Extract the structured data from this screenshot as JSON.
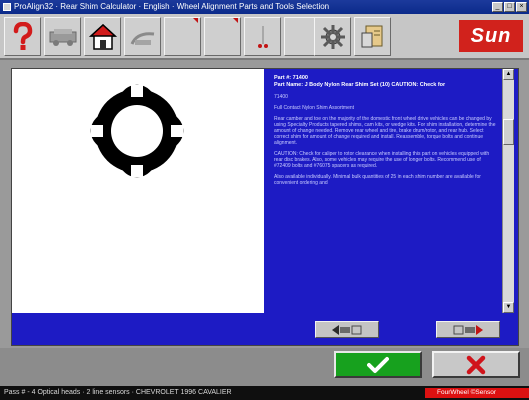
{
  "window": {
    "title": "ProAlign32 · Rear Shim Calculator · English · Wheel Alignment Parts and Tools Selection"
  },
  "toolbar": {
    "buttons": [
      {
        "name": "help-icon"
      },
      {
        "name": "vehicle-icon"
      },
      {
        "name": "home-icon"
      },
      {
        "name": "measure-icon"
      },
      {
        "name": "blank-1"
      },
      {
        "name": "blank-2"
      },
      {
        "name": "blank-3"
      },
      {
        "name": "blank-4"
      },
      {
        "name": "gear-icon"
      },
      {
        "name": "print-icon"
      }
    ],
    "brand_label": "Sun"
  },
  "part": {
    "header": "Part #: 71400\nPart Name: J Body Nylon Rear Shim Set (10) CAUTION: Check for",
    "number": "71400",
    "subtitle": "Full Contact Nylon Shim Assortment",
    "para1": "Rear camber and toe on the majority of the domestic front wheel drive vehicles can be changed by using Specialty Products tapered shims, cam kits, or wedge kits. For shim installation, determine the amount of change needed. Remove rear wheel and tire, brake drum/rotor, and rear hub. Select correct shim for amount of change required and install. Reassemble, torque bolts and continue alignment.",
    "para2": "CAUTION: Check for caliper to rotor clearance when installing this part on vehicles equipped with rear disc brakes. Also, some vehicles may require the use of longer bolts. Recommend use of #72409 bolts and #76075 spacers as required.",
    "para3": "Also available individually. Minimal bulk quantities of 25 in each shim number are available for convenient ordering and"
  },
  "status": {
    "left_text": "Pass # - 4 Optical heads · 2 line sensors · CHEVROLET 1996 CAVALIER",
    "right_text": "FourWheel ©Sensor"
  },
  "colors": {
    "panel_blue": "#1d1bc4",
    "ok_green": "#17a11e",
    "cancel_red": "#d0141b",
    "brand_red": "#d1221c"
  }
}
